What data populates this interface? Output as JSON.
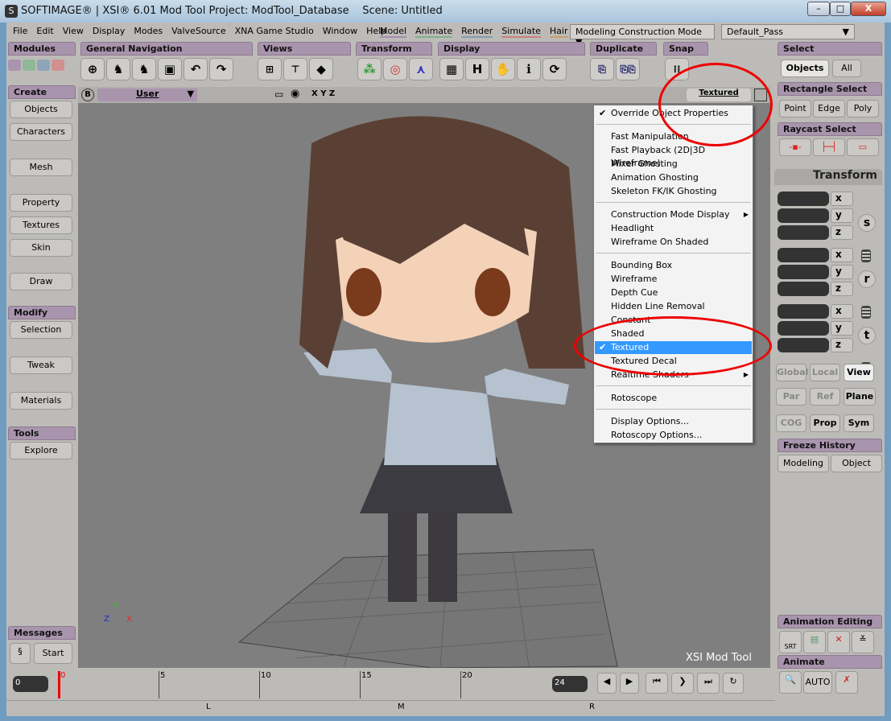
{
  "window": {
    "title": "SOFTIMAGE® | XSI® 6.01 Mod Tool Project: ModTool_Database",
    "scene": "Scene: Untitled",
    "minimize": "–",
    "maximize": "□",
    "close": "X"
  },
  "menu": [
    "File",
    "Edit",
    "View",
    "Display",
    "Modes",
    "ValveSource",
    "XNA Game Studio",
    "Window",
    "Help"
  ],
  "modules": [
    "Model",
    "Animate",
    "Render",
    "Simulate",
    "Hair"
  ],
  "construction_mode": "Modeling Construction Mode",
  "pass": "Default_Pass",
  "toolbar": {
    "modules": "Modules",
    "general_navigation": "General Navigation",
    "views": "Views",
    "transform": "Transform",
    "display": "Display",
    "duplicate": "Duplicate",
    "snap": "Snap",
    "select": "Select",
    "objects": "Objects",
    "all": "All",
    "H": "H",
    "i": "i"
  },
  "left_panel": {
    "create": "Create",
    "create_items": [
      "Objects",
      "Characters",
      "Mesh",
      "Property",
      "Textures",
      "Skin",
      "Draw"
    ],
    "modify": "Modify",
    "modify_items": [
      "Selection",
      "Tweak",
      "Materials"
    ],
    "tools": "Tools",
    "tools_items": [
      "Explore"
    ],
    "messages": "Messages",
    "start": "Start"
  },
  "viewport": {
    "badge": "B",
    "camera": "User",
    "axes": "X Y Z",
    "mode": "Textured",
    "watermark": "XSI Mod Tool",
    "axis_x": "X",
    "axis_y": "Y",
    "axis_z": "Z"
  },
  "context_menu": [
    {
      "label": "Override Object Properties",
      "checked": true
    },
    {
      "label": "Fast Manipulation"
    },
    {
      "label": "Fast Playback (2D|3D Wireframe)"
    },
    {
      "label": "Mixer Ghosting"
    },
    {
      "label": "Animation Ghosting"
    },
    {
      "label": "Skeleton FK/IK Ghosting"
    },
    {
      "label": "Construction Mode Display",
      "submenu": true
    },
    {
      "label": "Headlight"
    },
    {
      "label": "Wireframe On Shaded"
    },
    {
      "label": "Bounding Box"
    },
    {
      "label": "Wireframe"
    },
    {
      "label": "Depth Cue"
    },
    {
      "label": "Hidden Line Removal"
    },
    {
      "label": "Constant"
    },
    {
      "label": "Shaded"
    },
    {
      "label": "Textured",
      "checked": true,
      "selected": true
    },
    {
      "label": "Textured Decal"
    },
    {
      "label": "Realtime Shaders",
      "submenu": true
    },
    {
      "label": "Rotoscope"
    },
    {
      "label": "Display Options..."
    },
    {
      "label": "Rotoscopy Options..."
    }
  ],
  "right_panel": {
    "rect_select": "Rectangle Select",
    "point": "Point",
    "edge": "Edge",
    "poly": "Poly",
    "raycast_select": "Raycast Select",
    "transform": "Transform",
    "x": "x",
    "y": "y",
    "z": "z",
    "s": "s",
    "r": "r",
    "t": "t",
    "global": "Global",
    "local": "Local",
    "view": "View",
    "par": "Par",
    "ref": "Ref",
    "plane": "Plane",
    "cog": "COG",
    "prop": "Prop",
    "sym": "Sym",
    "freeze_history": "Freeze History",
    "modeling": "Modeling",
    "object": "Object",
    "animation_editing": "Animation Editing",
    "srt": "SRT",
    "animate": "Animate",
    "auto": "AUTO"
  },
  "timeline": {
    "start": "0",
    "end": "24",
    "current": 0,
    "ticks": [
      "0",
      "5",
      "10",
      "15",
      "20"
    ],
    "lmr": [
      "L",
      "M",
      "R"
    ]
  }
}
